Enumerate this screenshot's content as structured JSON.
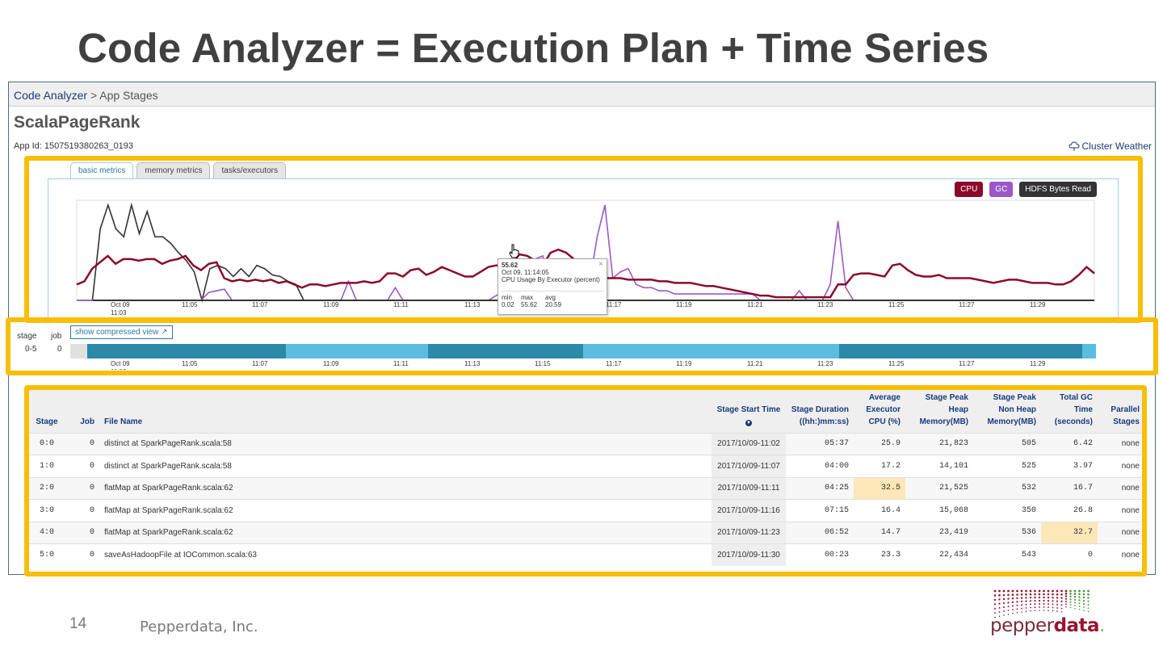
{
  "slide": {
    "title": "Code Analyzer = Execution Plan + Time Series",
    "page_number": "14",
    "company": "Pepperdata, Inc.",
    "logo": {
      "prefix": "pepper",
      "suffix": "data",
      "dot": "."
    }
  },
  "app": {
    "breadcrumb_link": "Code Analyzer",
    "breadcrumb_rest": " > App Stages",
    "name": "ScalaPageRank",
    "app_id_label": "App Id:",
    "app_id": "1507519380263_0193",
    "cluster_weather": "Cluster Weather"
  },
  "tabs": [
    "basic metrics",
    "memory metrics",
    "tasks/executors"
  ],
  "legend": [
    {
      "label": "CPU",
      "color": "#8b0a2a"
    },
    {
      "label": "GC",
      "color": "#9b59c6"
    },
    {
      "label": "HDFS Bytes Read",
      "color": "#333333"
    }
  ],
  "chart_data": {
    "type": "line",
    "x_ticks": [
      "Oct 09 11:03",
      "11:05",
      "11:07",
      "11:09",
      "11:11",
      "11:13",
      "11:15",
      "11:17",
      "11:19",
      "11:21",
      "11:23",
      "11:25",
      "11:27",
      "11:29"
    ],
    "series": [
      {
        "name": "CPU",
        "color": "#8b0a2a",
        "values": [
          10,
          12,
          20,
          24,
          28,
          23,
          26,
          26,
          25,
          26,
          26,
          23,
          25,
          26,
          28,
          22,
          19,
          23,
          24,
          14,
          12,
          13,
          12,
          13,
          12,
          13,
          11,
          12,
          10,
          8,
          10,
          10,
          9,
          10,
          11,
          11,
          11,
          12,
          11,
          12,
          17,
          17,
          15,
          19,
          20,
          16,
          18,
          21,
          19,
          17,
          15,
          15,
          18,
          21,
          22,
          22,
          23,
          29,
          28,
          25,
          22,
          30,
          32,
          30,
          26,
          18,
          16,
          15,
          14,
          14,
          14,
          13,
          13,
          13,
          13,
          12,
          12,
          11,
          11,
          11,
          10,
          9,
          9,
          8,
          7,
          6,
          5,
          4,
          3,
          3,
          2,
          2,
          2,
          2,
          2,
          2,
          2,
          2,
          10,
          10,
          16,
          17,
          17,
          16,
          15,
          22,
          23,
          19,
          16,
          15,
          15,
          16,
          14,
          14,
          14,
          14,
          13,
          12,
          11,
          12,
          13,
          13,
          12,
          11,
          11,
          11,
          10,
          10,
          12,
          16,
          21,
          17
        ],
        "note": ""
      },
      {
        "name": "GC",
        "color": "#9b59c6",
        "values": [
          0,
          0,
          0,
          0,
          0,
          0,
          0,
          0,
          0,
          0,
          0,
          0,
          0,
          0,
          0,
          0,
          0,
          5,
          6,
          7,
          0,
          0,
          0,
          0,
          0,
          0,
          0,
          0,
          0,
          0,
          0,
          0,
          0,
          0,
          0,
          12,
          0,
          0,
          0,
          0,
          0,
          8,
          0,
          0,
          0,
          0,
          0,
          0,
          0,
          0,
          0,
          0,
          0,
          0,
          3,
          6,
          12,
          18,
          24,
          26,
          28,
          0,
          14,
          22,
          18,
          14,
          10,
          40,
          60,
          14,
          18,
          20,
          10,
          8,
          8,
          6,
          6,
          4,
          4,
          4,
          4,
          4,
          4,
          4,
          4,
          4,
          4,
          4,
          0,
          0,
          0,
          0,
          0,
          6,
          0,
          0,
          0,
          10,
          50,
          8,
          0,
          0,
          0,
          0,
          0,
          0,
          0,
          0,
          0,
          0,
          0,
          0,
          0,
          0,
          0,
          0,
          0,
          0,
          0,
          0,
          0,
          0,
          0,
          0,
          0,
          0,
          0,
          0,
          0,
          0,
          0,
          0
        ],
        "note": ""
      },
      {
        "name": "HDFS Bytes Read",
        "color": "#333333",
        "values": [
          0,
          0,
          0,
          45,
          60,
          45,
          40,
          60,
          42,
          56,
          40,
          40,
          36,
          30,
          25,
          18,
          0,
          20,
          22,
          20,
          15,
          20,
          15,
          22,
          20,
          16,
          15,
          12,
          10,
          0,
          0,
          0,
          0,
          0,
          0,
          0,
          0,
          0,
          0,
          0,
          0,
          0,
          0,
          0,
          0,
          0,
          0,
          0,
          0,
          0,
          0,
          0,
          0,
          0,
          0,
          0,
          0,
          0,
          0,
          0,
          0,
          0,
          0,
          0,
          0,
          0,
          0,
          0,
          0,
          0,
          0,
          0,
          0,
          0,
          0,
          0,
          0,
          0,
          0,
          0,
          0,
          0,
          0,
          0,
          0,
          0,
          0,
          0,
          0,
          0,
          0,
          0,
          0,
          0,
          0,
          0,
          0,
          0,
          0,
          0,
          0,
          0,
          0,
          0,
          0,
          0,
          0,
          0,
          0,
          0,
          0,
          0,
          0,
          0,
          0,
          0,
          0,
          0,
          0,
          0,
          0,
          0,
          0,
          0,
          0,
          0,
          0,
          0,
          0,
          0,
          0
        ],
        "note": ""
      }
    ],
    "ylim": [
      0,
      60
    ]
  },
  "tooltip": {
    "value": "55.62",
    "time": "Oct 09, 11:14:05",
    "metric": "CPU Usage By Executor (percent)",
    "stats_headers": [
      "min",
      "max",
      "avg"
    ],
    "stats_values": [
      "0.02",
      "55.62",
      "20.59"
    ],
    "close": "×"
  },
  "timeline": {
    "stage_header": "stage",
    "job_header": "job",
    "stage_value": "0-5",
    "job_value": "0",
    "compress_label": "show compressed view",
    "ticks": [
      "Oct 09 11:03",
      "11:05",
      "11:07",
      "11:09",
      "11:11",
      "11:13",
      "11:15",
      "11:17",
      "11:19",
      "11:21",
      "11:23",
      "11:25",
      "11:27",
      "11:29"
    ],
    "segments": [
      {
        "stage": "0:0",
        "color": "#2a8aa8"
      },
      {
        "stage": "1:0",
        "color": "#5bbde0"
      },
      {
        "stage": "2:0",
        "color": "#2a8aa8"
      },
      {
        "stage": "3:0",
        "color": "#5bbde0"
      },
      {
        "stage": "4:0",
        "color": "#2a8aa8"
      },
      {
        "stage": "5:0",
        "color": "#5bbde0"
      }
    ]
  },
  "table": {
    "headers": {
      "stage": "Stage",
      "job": "Job",
      "file_name": "File Name",
      "start_time": "Stage Start Time",
      "duration": [
        "Stage Duration",
        "((hh:)mm:ss)"
      ],
      "cpu": [
        "Average",
        "Executor",
        "CPU (%)"
      ],
      "heap": [
        "Stage Peak",
        "Heap",
        "Memory(MB)"
      ],
      "nonheap": [
        "Stage Peak",
        "Non Heap",
        "Memory(MB)"
      ],
      "gc": [
        "Total GC",
        "Time",
        "(seconds)"
      ],
      "parallel": [
        "Parallel",
        "Stages"
      ]
    },
    "rows": [
      {
        "stage": "0:0",
        "job": "0",
        "file": "distinct at SparkPageRank.scala:58",
        "start": "2017/10/09-11:02",
        "duration": "05:37",
        "cpu": "25.9",
        "heap": "21,823",
        "nonheap": "505",
        "gc": "6.42",
        "parallel": "none"
      },
      {
        "stage": "1:0",
        "job": "0",
        "file": "distinct at SparkPageRank.scala:58",
        "start": "2017/10/09-11:07",
        "duration": "04:00",
        "cpu": "17.2",
        "heap": "14,101",
        "nonheap": "525",
        "gc": "3.97",
        "parallel": "none"
      },
      {
        "stage": "2:0",
        "job": "0",
        "file": "flatMap at SparkPageRank.scala:62",
        "start": "2017/10/09-11:11",
        "duration": "04:25",
        "cpu": "32.5",
        "heap": "21,525",
        "nonheap": "532",
        "gc": "16.7",
        "parallel": "none"
      },
      {
        "stage": "3:0",
        "job": "0",
        "file": "flatMap at SparkPageRank.scala:62",
        "start": "2017/10/09-11:16",
        "duration": "07:15",
        "cpu": "16.4",
        "heap": "15,068",
        "nonheap": "350",
        "gc": "26.8",
        "parallel": "none"
      },
      {
        "stage": "4:0",
        "job": "0",
        "file": "flatMap at SparkPageRank.scala:62",
        "start": "2017/10/09-11:23",
        "duration": "06:52",
        "cpu": "14.7",
        "heap": "23,419",
        "nonheap": "536",
        "gc": "32.7",
        "parallel": "none"
      },
      {
        "stage": "5:0",
        "job": "0",
        "file": "saveAsHadoopFile at IOCommon.scala:63",
        "start": "2017/10/09-11:30",
        "duration": "00:23",
        "cpu": "23.3",
        "heap": "22,434",
        "nonheap": "543",
        "gc": "0",
        "parallel": "none"
      }
    ],
    "highlight": {
      "cpu_row": 2,
      "gc_row": 4
    }
  },
  "colors": {
    "highlight_box": "#f8be08",
    "accent": "#2a7aa0",
    "title": "#404040"
  }
}
